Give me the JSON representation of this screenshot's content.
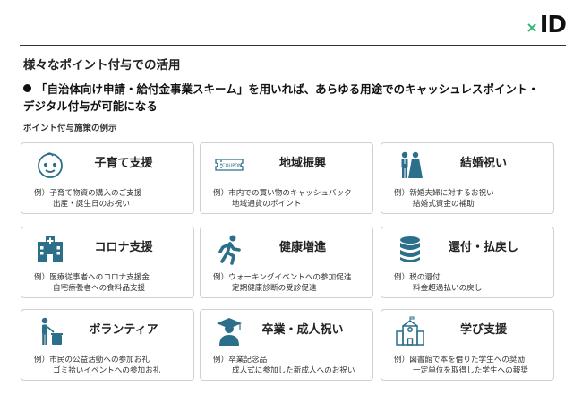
{
  "logo": {
    "mark": "×",
    "text": "ID"
  },
  "title": "様々なポイント付与での活用",
  "bullet": {
    "line1": "「自治体向け申請・給付金事業スキーム」を用いれば、あらゆる用途でのキャッシュレスポイント・",
    "line2": "デジタル付与が可能になる"
  },
  "section_label": "ポイント付与施策の例示",
  "accent_color": "#2b6f8a",
  "cards": [
    {
      "icon": "baby-face-icon",
      "title": "子育て支援",
      "desc1": "例）子育て物資の購入のご支援",
      "desc2": "出産・誕生日のお祝い"
    },
    {
      "icon": "coupon-icon",
      "title": "地域振興",
      "desc1": "例）市内での買い物のキャッシュバック",
      "desc2": "地域通貨のポイント"
    },
    {
      "icon": "wedding-couple-icon",
      "title": "結婚祝い",
      "desc1": "例）新婚夫婦に対するお祝い",
      "desc2": "結婚式資金の補助"
    },
    {
      "icon": "hospital-icon",
      "title": "コロナ支援",
      "desc1": "例）医療従事者へのコロナ支援金",
      "desc2": "自宅療養者への食料品支援"
    },
    {
      "icon": "running-person-icon",
      "title": "健康増進",
      "desc1": "例）ウォーキングイベントへの参加促進",
      "desc2": "定期健康診断の受診促進"
    },
    {
      "icon": "coin-stack-icon",
      "title": "還付・払戻し",
      "desc1": "例）税の還付",
      "desc2": "料金超過払いの戻し"
    },
    {
      "icon": "trash-volunteer-icon",
      "title": "ボランティア",
      "desc1": "例）市民の公益活動への参加お礼",
      "desc2": "ゴミ拾いイベントへの参加お礼"
    },
    {
      "icon": "graduate-icon",
      "title": "卒業・成人祝い",
      "desc1": "例）卒業記念品",
      "desc2": "成人式に参加した新成人へのお祝い"
    },
    {
      "icon": "school-building-icon",
      "title": "学び支援",
      "desc1": "例）図書館で本を借りた学生への奨励",
      "desc2": "一定単位を取得した学生への報奨"
    }
  ]
}
